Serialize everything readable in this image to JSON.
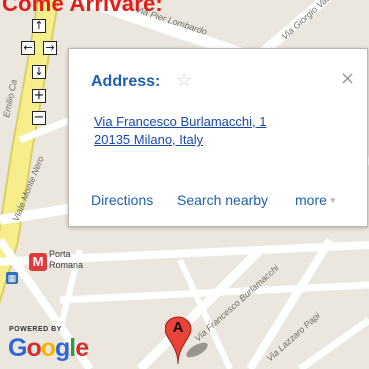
{
  "page": {
    "heading": "Come Arrivare:"
  },
  "controls": {
    "pan_up": "↑",
    "pan_left": "←",
    "pan_right": "→",
    "pan_down": "↓",
    "zoom_in": "+",
    "zoom_out": "−"
  },
  "info_window": {
    "title": "Address:",
    "star_icon": "☆",
    "close_icon": "×",
    "address_line1": "Via Francesco Burlamacchi, 1",
    "address_line2": "20135 Milano, Italy",
    "actions": {
      "directions": "Directions",
      "search_nearby": "Search nearby",
      "more": "more"
    },
    "more_caret": "▼"
  },
  "map": {
    "streets": {
      "pier_lombardo": "Via Pier Lombardo",
      "giorgio_vasari": "Via Giorgio Vasari",
      "monte_nero": "Viale Monte Nero",
      "emilio_caldara": "Emilio Ca",
      "burlamacchi": "Via Francesco Burlamacchi",
      "papi": "Via Lazzaro Papi"
    },
    "metro": {
      "badge": "M",
      "label_line1": "Porta",
      "label_line2": "Romana"
    },
    "transit_icon": "▦",
    "marker_label": "A"
  },
  "branding": {
    "powered_by": "POWERED BY",
    "google": [
      "G",
      "o",
      "o",
      "g",
      "l",
      "e"
    ]
  },
  "colors": {
    "heading": "#e41b17",
    "link": "#1e5fae",
    "map_background": "#ece7de",
    "major_road": "#f6ee8a",
    "marker": "#e8433a"
  }
}
